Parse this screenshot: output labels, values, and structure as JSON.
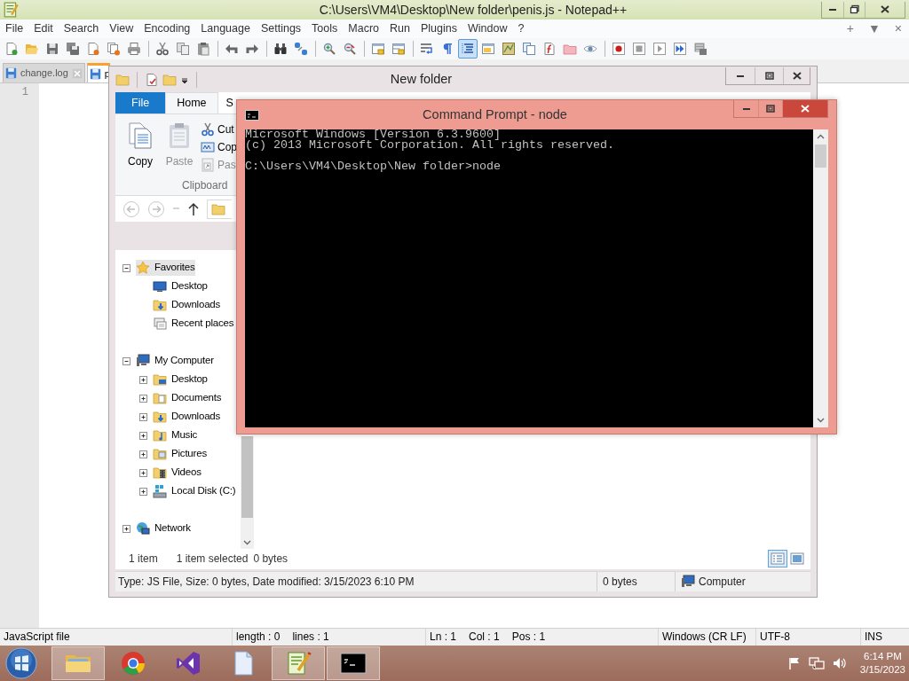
{
  "notepad": {
    "title": "C:\\Users\\VM4\\Desktop\\New folder\\penis.js - Notepad++",
    "menu": [
      "File",
      "Edit",
      "Search",
      "View",
      "Encoding",
      "Language",
      "Settings",
      "Tools",
      "Macro",
      "Run",
      "Plugins",
      "Window",
      "?"
    ],
    "menu_controls": [
      "+",
      "▼",
      "×"
    ],
    "toolbar": [
      [
        {
          "kind": "new",
          "pressed": false
        },
        {
          "kind": "open",
          "pressed": false
        },
        {
          "kind": "save",
          "pressed": false
        },
        {
          "kind": "save_all",
          "pressed": false
        },
        {
          "kind": "close",
          "pressed": false
        },
        {
          "kind": "close_all",
          "pressed": false
        },
        {
          "kind": "print",
          "pressed": false
        }
      ],
      [
        {
          "kind": "cut",
          "pressed": false
        },
        {
          "kind": "copy",
          "pressed": false
        },
        {
          "kind": "paste",
          "pressed": false
        }
      ],
      [
        {
          "kind": "undo",
          "pressed": false
        },
        {
          "kind": "redo",
          "pressed": false
        }
      ],
      [
        {
          "kind": "find",
          "pressed": false
        },
        {
          "kind": "replace",
          "pressed": false
        }
      ],
      [
        {
          "kind": "zoom_in",
          "pressed": false
        },
        {
          "kind": "zoom_out",
          "pressed": false
        }
      ],
      [
        {
          "kind": "sync_v",
          "pressed": false
        },
        {
          "kind": "sync_h",
          "pressed": false
        }
      ],
      [
        {
          "kind": "wrap",
          "pressed": false
        },
        {
          "kind": "all_chars",
          "pressed": false
        },
        {
          "kind": "indent_guide",
          "pressed": true
        },
        {
          "kind": "udl",
          "pressed": false
        },
        {
          "kind": "doc_map",
          "pressed": false
        },
        {
          "kind": "doc_list",
          "pressed": false
        },
        {
          "kind": "function_list",
          "pressed": false
        },
        {
          "kind": "folder_workspace",
          "pressed": false
        },
        {
          "kind": "monitor",
          "pressed": false
        }
      ],
      [
        {
          "kind": "record",
          "pressed": false
        },
        {
          "kind": "stop",
          "pressed": false
        },
        {
          "kind": "play",
          "pressed": false
        },
        {
          "kind": "play_multiple",
          "pressed": false
        },
        {
          "kind": "save_macro",
          "pressed": false
        }
      ]
    ],
    "tabs": [
      {
        "label": "change.log",
        "selected": false
      },
      {
        "label": "p",
        "selected": true
      }
    ],
    "line_numbers": [
      "1"
    ],
    "status_bar": [
      [
        "JavaScript file"
      ],
      [
        "length : 0",
        "lines : 1"
      ],
      [
        "Ln : 1",
        "Col : 1",
        "Pos : 1"
      ],
      [
        "Windows (CR LF)"
      ],
      [
        "UTF-8"
      ],
      [
        "INS"
      ]
    ]
  },
  "explorer": {
    "title": "New folder",
    "ribbon_tabs": [
      {
        "label": "File",
        "kind": "app_menu",
        "selected": false
      },
      {
        "label": "Home",
        "kind": "tab",
        "selected": true
      },
      {
        "label": "S",
        "kind": "tab",
        "selected": false
      }
    ],
    "clipboard": {
      "large": [
        {
          "label": "Copy",
          "kind": "copy",
          "disabled": false
        },
        {
          "label": "Paste",
          "kind": "paste",
          "disabled": true
        }
      ],
      "small": [
        {
          "label": "Cut",
          "kind": "cut",
          "disabled": false
        },
        {
          "label": "Cop",
          "kind": "copy_path",
          "disabled": false
        },
        {
          "label": "Pas",
          "kind": "paste_shortcut",
          "disabled": true
        }
      ],
      "group_label": "Clipboard"
    },
    "tree": [
      {
        "label": "Favorites",
        "kind": "favorites",
        "expanded": true,
        "selected": true,
        "children": [
          {
            "label": "Desktop",
            "kind": "desktop",
            "selected": false
          },
          {
            "label": "Downloads",
            "kind": "downloads",
            "selected": false
          },
          {
            "label": "Recent places",
            "kind": "recent",
            "selected": false
          }
        ]
      },
      {
        "label": "My Computer",
        "kind": "computer",
        "expanded": true,
        "selected": false,
        "children": [
          {
            "label": "Desktop",
            "kind": "desktop_folder",
            "expanded": false,
            "selected": false
          },
          {
            "label": "Documents",
            "kind": "documents",
            "expanded": false,
            "selected": false
          },
          {
            "label": "Downloads",
            "kind": "downloads",
            "expanded": false,
            "selected": false
          },
          {
            "label": "Music",
            "kind": "music",
            "expanded": false,
            "selected": false
          },
          {
            "label": "Pictures",
            "kind": "pictures",
            "expanded": false,
            "selected": false
          },
          {
            "label": "Videos",
            "kind": "videos",
            "expanded": false,
            "selected": false
          },
          {
            "label": "Local Disk (C:)",
            "kind": "drive",
            "expanded": false,
            "selected": false
          }
        ]
      },
      {
        "label": "Network",
        "kind": "network",
        "expanded": false,
        "selected": false
      }
    ],
    "status": {
      "count": "1 item",
      "selection": "1 item selected",
      "size": "0 bytes"
    },
    "views": [
      {
        "kind": "details",
        "selected": true
      },
      {
        "kind": "large_icons",
        "selected": false
      }
    ],
    "details_bar": {
      "info": "Type: JS File, Size: 0 bytes, Date modified: 3/15/2023 6:10 PM",
      "size": "0 bytes",
      "location": "Computer"
    }
  },
  "cmd": {
    "title": "Command Prompt - node",
    "paragraphs": [
      [
        "Microsoft Windows [Version 6.3.9600]",
        "(c) 2013 Microsoft Corporation. All rights reserved."
      ],
      [
        "C:\\Users\\VM4\\Desktop\\New folder>node"
      ]
    ]
  },
  "taskbar": {
    "apps": [
      {
        "kind": "file_explorer",
        "active": true
      },
      {
        "kind": "browser",
        "active": false
      },
      {
        "kind": "ide",
        "active": false
      },
      {
        "kind": "document",
        "active": false
      },
      {
        "kind": "notepad",
        "active": true
      },
      {
        "kind": "console",
        "active": true
      }
    ],
    "time": "6:14 PM",
    "date": "3/15/2023"
  }
}
